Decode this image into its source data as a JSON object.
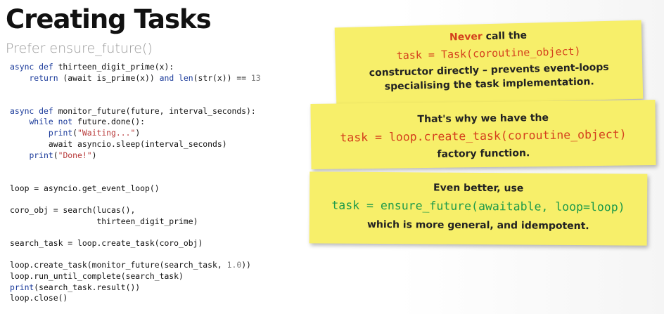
{
  "slide": {
    "title": "Creating Tasks",
    "subtitle": "Prefer ensure_future()"
  },
  "code_lines": [
    [
      [
        "kw",
        "async def "
      ],
      [
        "",
        "thirteen_digit_prime(x):"
      ]
    ],
    [
      [
        "",
        "    "
      ],
      [
        "kw",
        "return "
      ],
      [
        "",
        "(await is_prime(x)) "
      ],
      [
        "kw",
        "and "
      ],
      [
        "builtin",
        "len"
      ],
      [
        "",
        "(str(x)) == "
      ],
      [
        "num",
        "13"
      ]
    ],
    [
      [
        "",
        ""
      ]
    ],
    [
      [
        "",
        ""
      ]
    ],
    [
      [
        "kw",
        "async def "
      ],
      [
        "",
        "monitor_future(future, interval_seconds):"
      ]
    ],
    [
      [
        "",
        "    "
      ],
      [
        "kw",
        "while not "
      ],
      [
        "",
        "future.done():"
      ]
    ],
    [
      [
        "",
        "        "
      ],
      [
        "builtin",
        "print"
      ],
      [
        "",
        "("
      ],
      [
        "str",
        "\"Waiting...\""
      ],
      [
        "",
        ")"
      ]
    ],
    [
      [
        "",
        "        await asyncio.sleep(interval_seconds)"
      ]
    ],
    [
      [
        "",
        "    "
      ],
      [
        "builtin",
        "print"
      ],
      [
        "",
        "("
      ],
      [
        "str",
        "\"Done!\""
      ],
      [
        "",
        ")"
      ]
    ],
    [
      [
        "",
        ""
      ]
    ],
    [
      [
        "",
        ""
      ]
    ],
    [
      [
        "",
        "loop = asyncio.get_event_loop()"
      ]
    ],
    [
      [
        "",
        ""
      ]
    ],
    [
      [
        "",
        "coro_obj = search(lucas(),"
      ]
    ],
    [
      [
        "",
        "                  thirteen_digit_prime)"
      ]
    ],
    [
      [
        "",
        ""
      ]
    ],
    [
      [
        "",
        "search_task = loop.create_task(coro_obj)"
      ]
    ],
    [
      [
        "",
        ""
      ]
    ],
    [
      [
        "",
        "loop.create_task(monitor_future(search_task, "
      ],
      [
        "num",
        "1.0"
      ],
      [
        "",
        "))"
      ]
    ],
    [
      [
        "",
        "loop.run_until_complete(search_task)"
      ]
    ],
    [
      [
        "builtin",
        "print"
      ],
      [
        "",
        "(search_task.result())"
      ]
    ],
    [
      [
        "",
        "loop.close()"
      ]
    ]
  ],
  "notes": {
    "note1": {
      "prefix_red": "Never",
      "line1_rest": " call the",
      "code": "task = Task(coroutine_object)",
      "line3": "constructor directly – prevents event-loops",
      "line4": "specialising the task implementation."
    },
    "note2": {
      "line1": "That's why we have the",
      "code": "task = loop.create_task(coroutine_object)",
      "line3": "factory function."
    },
    "note3": {
      "line1": "Even better, use",
      "code": "task = ensure_future(awaitable, loop=loop)",
      "line3": "which is more general, and idempotent."
    }
  },
  "colors": {
    "note_yellow": "#f7ef6a",
    "red_accent": "#d4401d",
    "green_accent": "#1d9a4a"
  }
}
